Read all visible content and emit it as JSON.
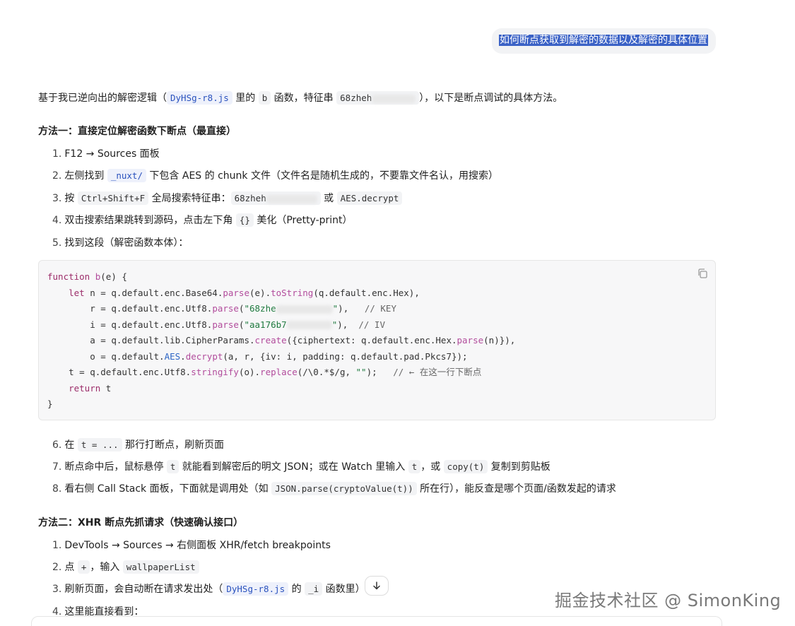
{
  "user_message": "如何断点获取到解密的数据以及解密的具体位置",
  "intro": {
    "t1": "基于我已逆向出的解密逻辑（",
    "c1": "DyHSg-r8.js",
    "t2": " 里的 ",
    "c2": "b",
    "t3": " 函数，特征串 ",
    "c3": "68zheh",
    "t4": "），以下是断点调试的具体方法。"
  },
  "method1": {
    "heading": "方法一：直接定位解密函数下断点（最直接）",
    "s1": "F12 → Sources 面板",
    "s2_a": "左侧找到 ",
    "s2_code": "_nuxt/",
    "s2_b": " 下包含 AES 的 chunk 文件（文件名是随机生成的，不要靠文件名认，用搜索）",
    "s3_a": "按 ",
    "s3_code1": "Ctrl+Shift+F",
    "s3_b": " 全局搜索特征串：",
    "s3_code2": "68zheh",
    "s3_c": " 或 ",
    "s3_code3": "AES.decrypt",
    "s4_a": "双击搜索结果跳转到源码，点击左下角 ",
    "s4_code": "{}",
    "s4_b": " 美化（Pretty-print）",
    "s5": "找到这段（解密函数本体）：",
    "code": {
      "l1_kw": "function",
      "l1_fn": " b",
      "l1_rest": "(e) {",
      "l2_kw": "let",
      "l2_a": " n = q.default.enc.Base64.",
      "l2_m1": "parse",
      "l2_b": "(e).",
      "l2_m2": "toString",
      "l2_c": "(q.default.enc.Hex),",
      "l3_a": "r = q.default.enc.Utf8.",
      "l3_m": "parse",
      "l3_b": "(",
      "l3_str": "\"68zhe",
      "l3_str2": "\"",
      "l3_c": "),   ",
      "l3_cm": "// KEY",
      "l4_a": "i = q.default.enc.Utf8.",
      "l4_m": "parse",
      "l4_b": "(",
      "l4_str": "\"aa176b7",
      "l4_str2": "\"",
      "l4_c": "),  ",
      "l4_cm": "// IV",
      "l5_a": "a = q.default.lib.CipherParams.",
      "l5_m1": "create",
      "l5_b": "({ciphertext: q.default.enc.Hex.",
      "l5_m2": "parse",
      "l5_c": "(n)}),",
      "l6_a": "o = q.default.",
      "l6_m1": "AES",
      "l6_b": ".",
      "l6_m2": "decrypt",
      "l6_c": "(a, r, {iv: i, padding: q.default.pad.Pkcs7});",
      "l7_a": "t = q.default.enc.Utf8.",
      "l7_m1": "stringify",
      "l7_b": "(o).",
      "l7_m2": "replace",
      "l7_c": "(/\\0.*$/g, ",
      "l7_str": "\"\"",
      "l7_d": ");   ",
      "l7_cm": "// ← 在这一行下断点",
      "l8_kw": "return",
      "l8_rest": " t",
      "l9": "}"
    },
    "s6_a": "在 ",
    "s6_code": "t = ...",
    "s6_b": " 那行打断点，刷新页面",
    "s7_a": "断点命中后，鼠标悬停 ",
    "s7_code1": "t",
    "s7_b": " 就能看到解密后的明文 JSON；或在 Watch 里输入 ",
    "s7_code2": "t",
    "s7_c": "，或 ",
    "s7_code3": "copy(t)",
    "s7_d": " 复制到剪贴板",
    "s8_a": "看右侧 Call Stack 面板，下面就是调用处（如 ",
    "s8_code": "JSON.parse(cryptoValue(t))",
    "s8_b": " 所在行），能反查是哪个页面/函数发起的请求"
  },
  "method2": {
    "heading": "方法二：XHR 断点先抓请求（快速确认接口）",
    "s1": "DevTools → Sources → 右侧面板 XHR/fetch breakpoints",
    "s2_a": "点 ",
    "s2_code1": "+",
    "s2_b": "，输入 ",
    "s2_code2": "wallpaperList",
    "s3_a": "刷新页面，会自动断在请求发出处（",
    "s3_code1": "DyHSg-r8.js",
    "s3_b": " 的 ",
    "s3_code2": "_i",
    "s3_c": " 函数里）",
    "s4": "这里能直接看到："
  },
  "watermark": "掘金技术社区 @ SimonKing"
}
